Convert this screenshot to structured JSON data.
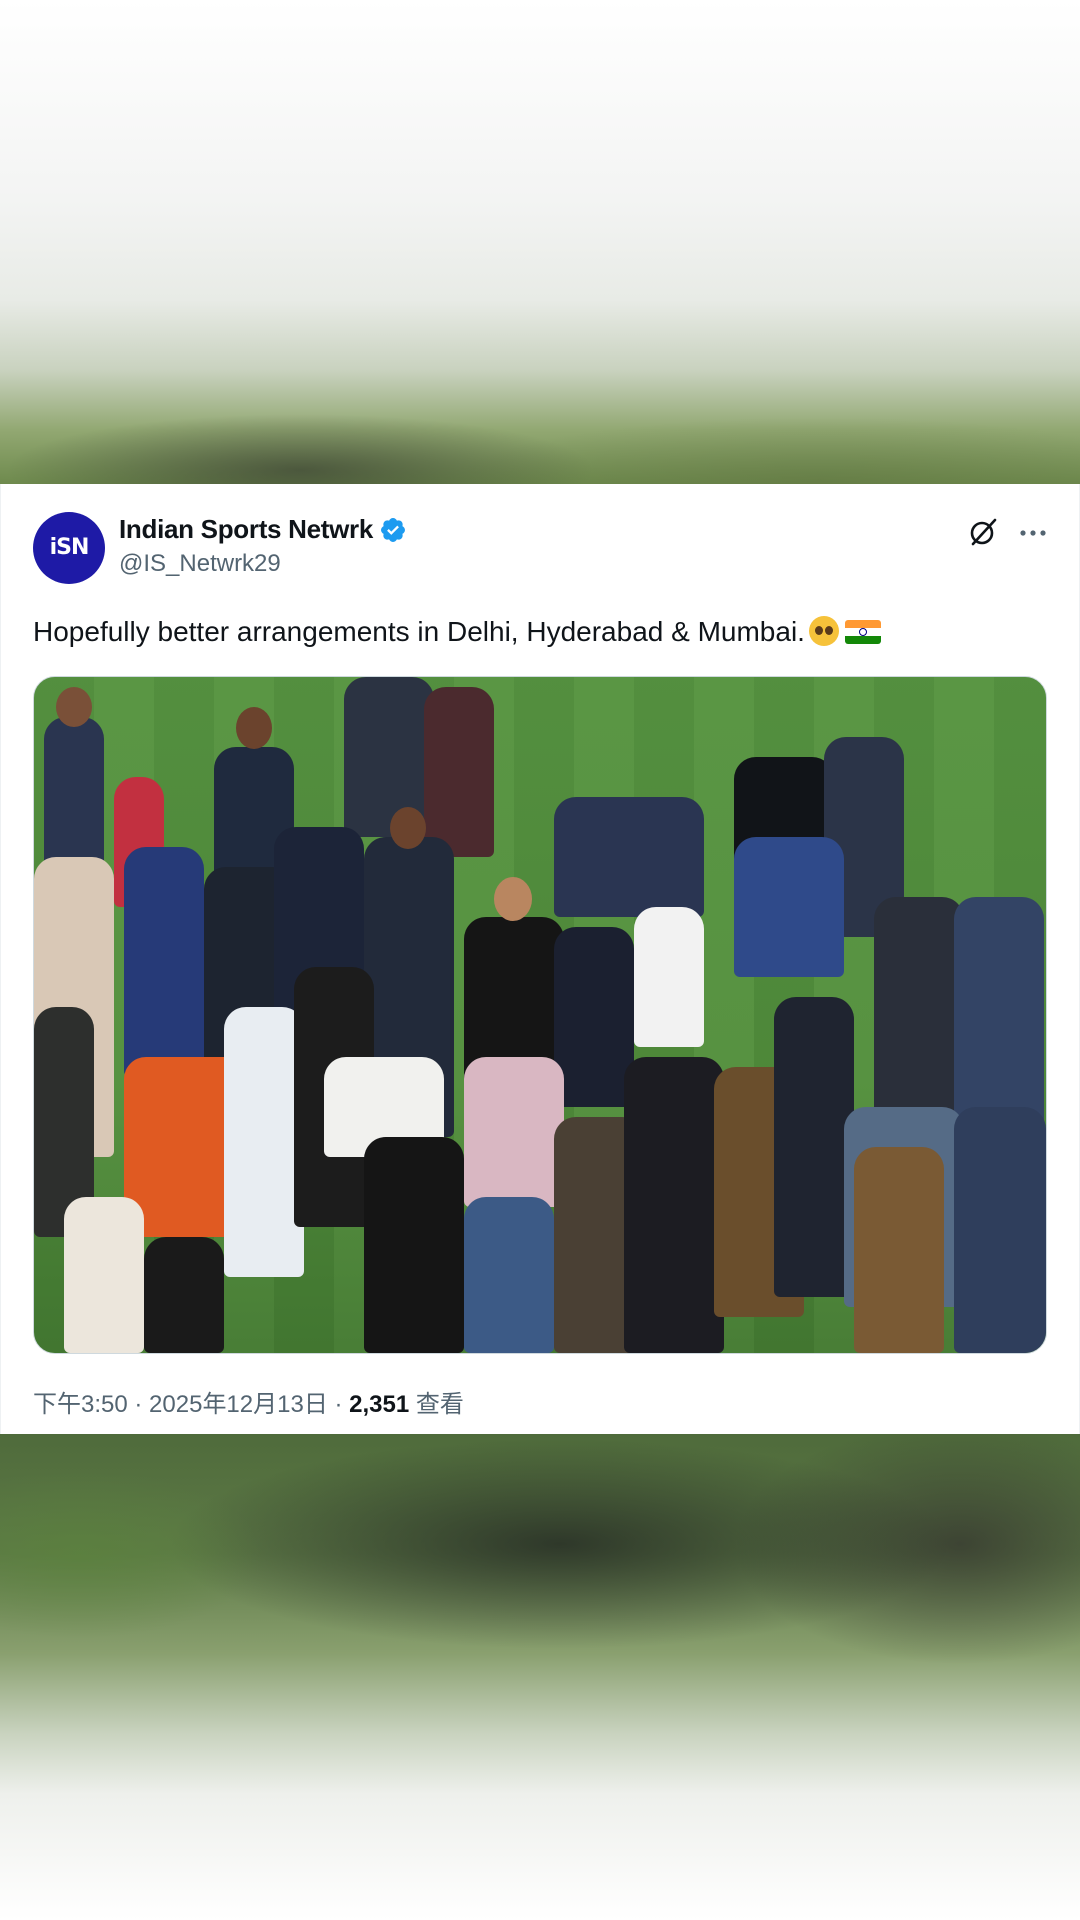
{
  "tweet": {
    "author": {
      "display_name": "Indian Sports Netwrk",
      "handle": "@IS_Netwrk29",
      "avatar_text": "iSN",
      "verified": true
    },
    "text": "Hopefully better arrangements in Delhi, Hyderabad & Mumbai.",
    "emojis": [
      "pleading-face",
      "flag-india"
    ],
    "photo_alt": "Crowd of officials, security and players gathered around a man in black on a football pitch",
    "meta": {
      "time": "下午3:50",
      "separator1": " · ",
      "date": "2025年12月13日",
      "separator2": " · ",
      "views_count": "2,351",
      "views_label": " 查看"
    }
  },
  "icons": {
    "grok": "grok-icon",
    "more": "more-icon",
    "verified": "verified-badge-icon"
  },
  "colors": {
    "text_primary": "#0f1419",
    "text_secondary": "#536471",
    "verified_blue": "#1d9bf0",
    "avatar_bg": "#1e1aa6"
  }
}
